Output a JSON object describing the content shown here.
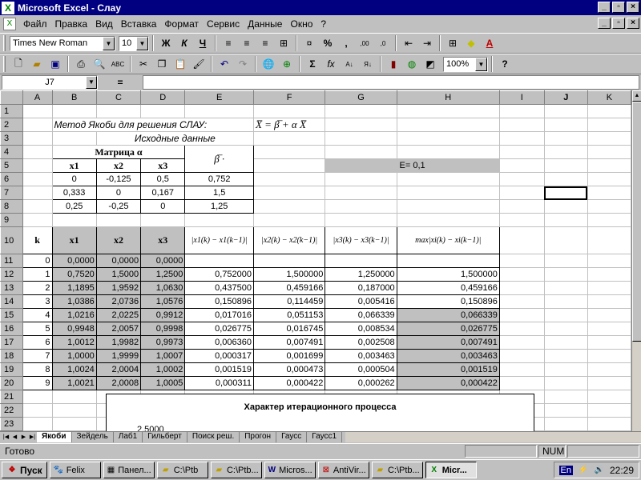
{
  "window": {
    "title": "Microsoft Excel - Слау"
  },
  "menu": [
    "Файл",
    "Правка",
    "Вид",
    "Вставка",
    "Формат",
    "Сервис",
    "Данные",
    "Окно",
    "?"
  ],
  "format_toolbar": {
    "font": "Times New Roman",
    "size": "10"
  },
  "std_toolbar": {
    "zoom": "100%"
  },
  "formula_bar": {
    "cell_ref": "J7",
    "equals": "="
  },
  "columns": [
    "A",
    "B",
    "C",
    "D",
    "E",
    "F",
    "G",
    "H",
    "I",
    "J",
    "K"
  ],
  "sheet": {
    "r2_title": "Метод Якоби для решения СЛАУ:",
    "r2_formula": "X̅ = β̅ + α X̅",
    "r3_label": "Исходные данные",
    "r4_matrix": "Матрица α",
    "r4_beta": "β̅ ·",
    "r5_headers": [
      "x1",
      "x2",
      "x3"
    ],
    "r5_eps": "E= 0,1",
    "matrix_rows": [
      [
        "0",
        "-0,125",
        "0,5",
        "0,752"
      ],
      [
        "0,333",
        "0",
        "0,167",
        "1,5"
      ],
      [
        "0,25",
        "-0,25",
        "0",
        "1,25"
      ]
    ],
    "r10_headers": [
      "k",
      "x1",
      "x2",
      "x3",
      "|x1(k) − x1(k−1)|",
      "|x2(k) − x2(k−1)|",
      "|x3(k) − x3(k−1)|",
      "max|xi(k) − xi(k−1)|"
    ],
    "iter_rows": [
      [
        "0",
        "0,0000",
        "0,0000",
        "0,0000",
        "",
        "",
        "",
        ""
      ],
      [
        "1",
        "0,7520",
        "1,5000",
        "1,2500",
        "0,752000",
        "1,500000",
        "1,250000",
        "1,500000"
      ],
      [
        "2",
        "1,1895",
        "1,9592",
        "1,0630",
        "0,437500",
        "0,459166",
        "0,187000",
        "0,459166"
      ],
      [
        "3",
        "1,0386",
        "2,0736",
        "1,0576",
        "0,150896",
        "0,114459",
        "0,005416",
        "0,150896"
      ],
      [
        "4",
        "1,0216",
        "2,0225",
        "0,9912",
        "0,017016",
        "0,051153",
        "0,066339",
        "0,066339"
      ],
      [
        "5",
        "0,9948",
        "2,0057",
        "0,9998",
        "0,026775",
        "0,016745",
        "0,008534",
        "0,026775"
      ],
      [
        "6",
        "1,0012",
        "1,9982",
        "0,9973",
        "0,006360",
        "0,007491",
        "0,002508",
        "0,007491"
      ],
      [
        "7",
        "1,0000",
        "1,9999",
        "1,0007",
        "0,000317",
        "0,001699",
        "0,003463",
        "0,003463"
      ],
      [
        "8",
        "1,0024",
        "2,0004",
        "1,0002",
        "0,001519",
        "0,000473",
        "0,000504",
        "0,001519"
      ],
      [
        "9",
        "1,0021",
        "2,0008",
        "1,0005",
        "0,000311",
        "0,000422",
        "0,000262",
        "0,000422"
      ]
    ]
  },
  "chart": {
    "title": "Характер итерационного процесса",
    "ytick": "2,5000"
  },
  "tabs": [
    "Якоби",
    "Зейдель",
    "Лаб1",
    "Гильберт",
    "Поиск реш.",
    "Прогон",
    "Гаусс",
    "Гаусс1"
  ],
  "status": {
    "text": "Готово",
    "num": "NUM"
  },
  "taskbar": {
    "start": "Пуск",
    "tasks": [
      "Felix",
      "Панел...",
      "C:\\Ptb",
      "C:\\Ptb...",
      "Micros...",
      "AntiVir...",
      "C:\\Ptb...",
      "Micr..."
    ],
    "lang": "En",
    "clock": "22:29"
  }
}
